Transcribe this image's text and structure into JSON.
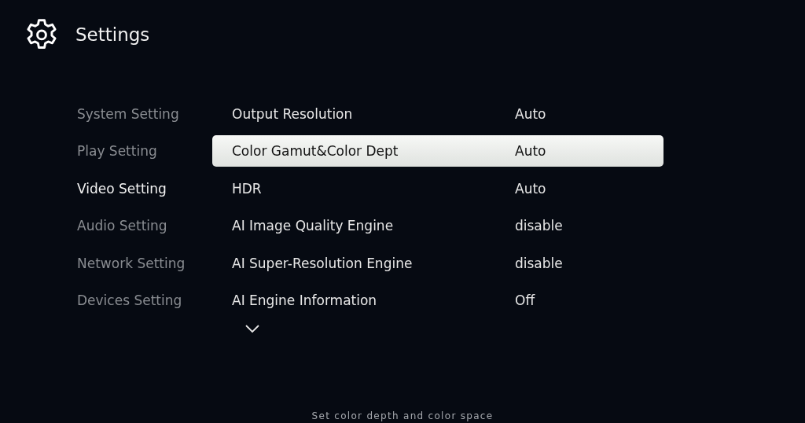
{
  "header": {
    "title": "Settings"
  },
  "sidebar": {
    "items": [
      {
        "label": "System Setting",
        "selected": false
      },
      {
        "label": "Play Setting",
        "selected": false
      },
      {
        "label": "Video Setting",
        "selected": true
      },
      {
        "label": "Audio Setting",
        "selected": false
      },
      {
        "label": "Network Setting",
        "selected": false
      },
      {
        "label": "Devices Setting",
        "selected": false
      }
    ]
  },
  "options": [
    {
      "label": "Output Resolution",
      "value": "Auto",
      "selected": false
    },
    {
      "label": "Color Gamut&Color Dept",
      "value": "Auto",
      "selected": true
    },
    {
      "label": "HDR",
      "value": "Auto",
      "selected": false
    },
    {
      "label": "AI Image Quality Engine",
      "value": "disable",
      "selected": false
    },
    {
      "label": "AI Super-Resolution Engine",
      "value": "disable",
      "selected": false
    },
    {
      "label": "AI Engine Information",
      "value": "Off",
      "selected": false
    }
  ],
  "more_below": true,
  "hint": "Set color depth and color space"
}
